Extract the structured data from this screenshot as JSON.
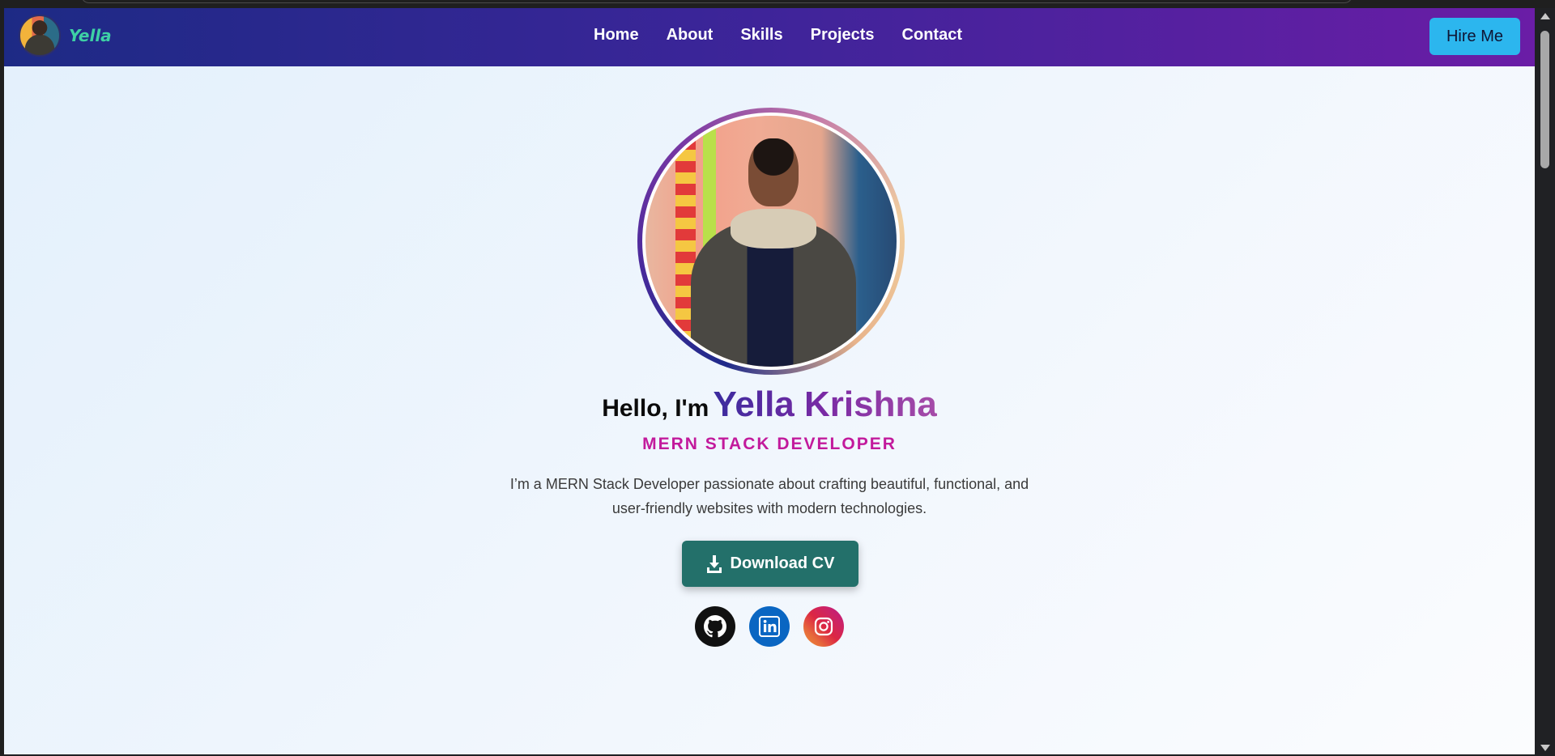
{
  "brand": {
    "name": "Yella"
  },
  "nav": {
    "links": [
      {
        "label": "Home"
      },
      {
        "label": "About"
      },
      {
        "label": "Skills"
      },
      {
        "label": "Projects"
      },
      {
        "label": "Contact"
      }
    ],
    "hire_label": "Hire Me"
  },
  "hero": {
    "greeting": "Hello, I'm",
    "name": "Yella Krishna",
    "role": "MERN STACK DEVELOPER",
    "intro": "I’m a MERN Stack Developer passionate about crafting beautiful, functional, and user-friendly websites with modern technologies.",
    "download_label": "Download CV"
  },
  "socials": [
    {
      "icon": "github-icon",
      "color": "#111111"
    },
    {
      "icon": "linkedin-icon",
      "color": "#0a66c2"
    },
    {
      "icon": "instagram-icon",
      "color": "#dc2743"
    }
  ],
  "colors": {
    "nav_gradient_start": "#1d2a85",
    "nav_gradient_end": "#6a1da6",
    "hire_button": "#2cb6ee",
    "download_button": "#23706a",
    "role_text": "#c21a9c",
    "brand_text": "#3ed0a5"
  }
}
